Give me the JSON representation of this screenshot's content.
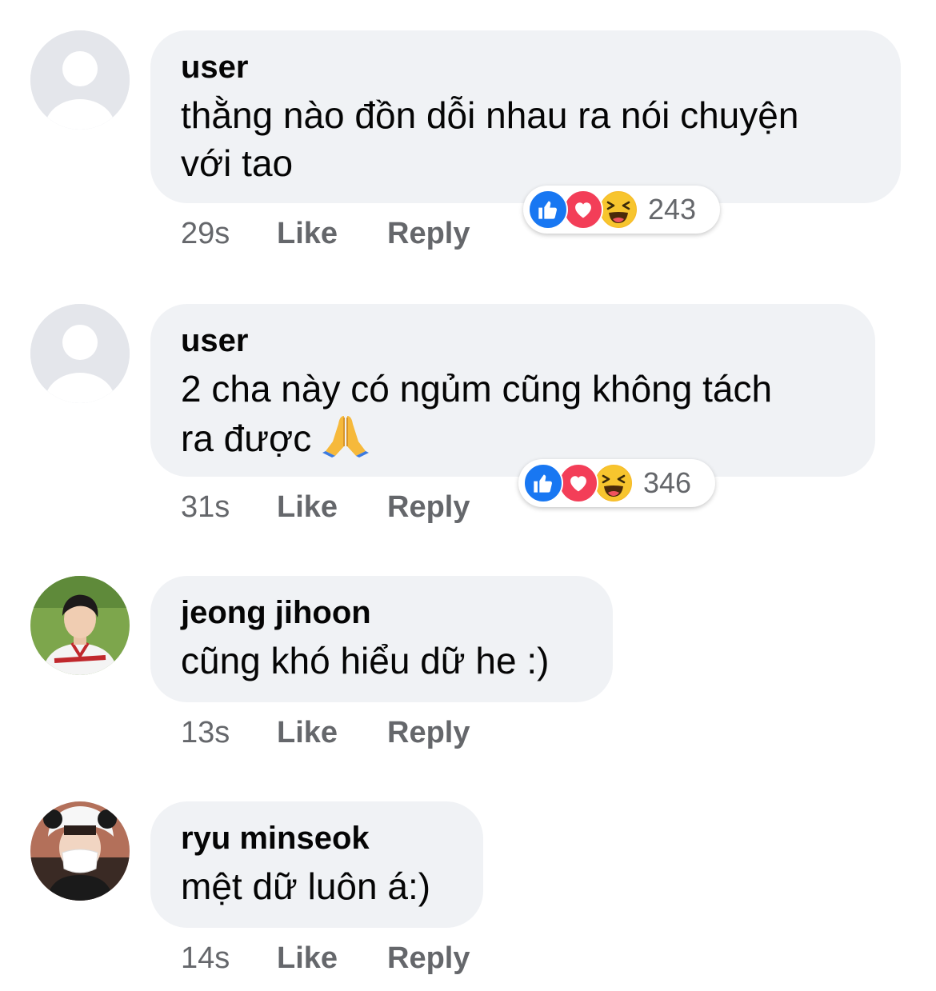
{
  "comments": [
    {
      "author": "user",
      "text": "thằng nào đồn dỗi nhau ra nói chuyện\nvới tao",
      "time": "29s",
      "like_label": "Like",
      "reply_label": "Reply",
      "reaction_count": "243",
      "reactions": [
        "like-icon",
        "love-icon",
        "haha-icon"
      ],
      "avatar": "default-avatar"
    },
    {
      "author": "user",
      "text": "2 cha này có ngủm cũng không tách\nra được",
      "emoji": "folded-hands-emoji",
      "time": "31s",
      "like_label": "Like",
      "reply_label": "Reply",
      "reaction_count": "346",
      "reactions": [
        "like-icon",
        "love-icon",
        "haha-icon"
      ],
      "avatar": "default-avatar"
    },
    {
      "author": "jeong jihoon",
      "text": "cũng khó hiểu dữ he :)",
      "time": "13s",
      "like_label": "Like",
      "reply_label": "Reply",
      "avatar": "profile-photo"
    },
    {
      "author": "ryu minseok",
      "text": "mệt dữ luôn á:)",
      "time": "14s",
      "like_label": "Like",
      "reply_label": "Reply",
      "avatar": "profile-photo"
    }
  ],
  "colors": {
    "bubble": "#f0f2f5",
    "meta_text": "#65676b",
    "like_blue": "#1877f2",
    "love_red": "#f33e58",
    "haha_yellow": "#f7b928"
  }
}
